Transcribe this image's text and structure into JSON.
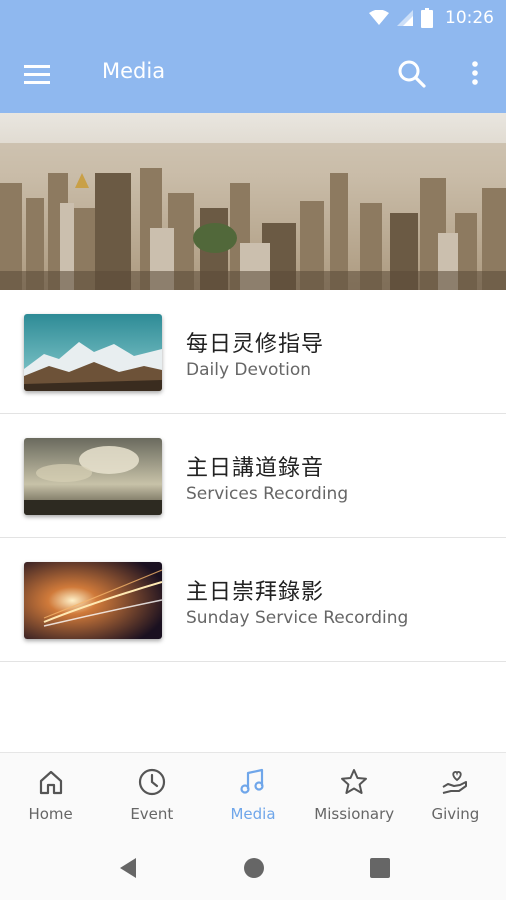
{
  "status_bar": {
    "time": "10:26",
    "icons": [
      "wifi-icon",
      "signal-icon",
      "battery-icon"
    ]
  },
  "app_bar": {
    "title": "Media",
    "icons": [
      "menu-icon",
      "search-icon",
      "more-vert-icon"
    ]
  },
  "media_items": [
    {
      "title": "每日灵修指导",
      "subtitle": "Daily Devotion",
      "thumbnail": "mountain-landscape"
    },
    {
      "title": "主日講道錄音",
      "subtitle": "Services Recording",
      "thumbnail": "cloudy-sky"
    },
    {
      "title": "主日崇拜錄影",
      "subtitle": "Sunday Service Recording",
      "thumbnail": "light-trails"
    }
  ],
  "bottom_nav": {
    "items": [
      {
        "label": "Home",
        "icon": "home-icon"
      },
      {
        "label": "Event",
        "icon": "clock-icon"
      },
      {
        "label": "Media",
        "icon": "music-note-icon",
        "active": true
      },
      {
        "label": "Missionary",
        "icon": "star-icon"
      },
      {
        "label": "Giving",
        "icon": "heart-hand-icon"
      }
    ]
  },
  "colors": {
    "primary": "#8fb8ef",
    "accent": "#6fa6ea",
    "text_primary": "#222222",
    "text_secondary": "#666666"
  }
}
